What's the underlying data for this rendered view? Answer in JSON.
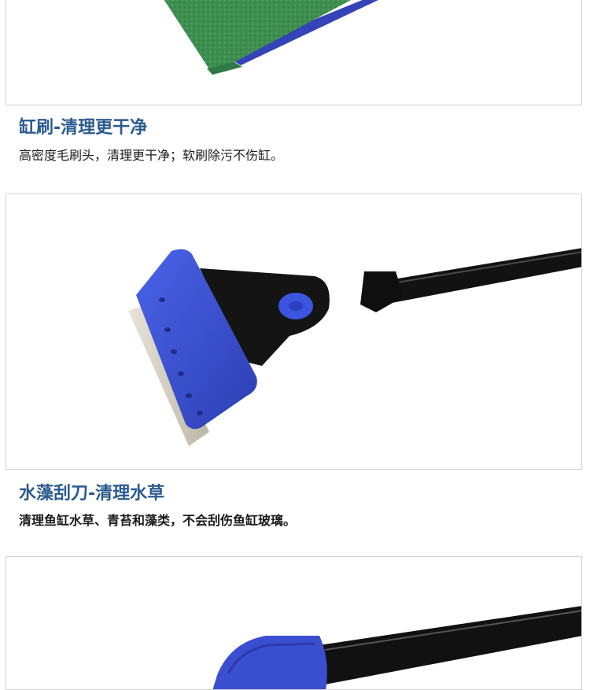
{
  "sections": [
    {
      "image": "sponge-brush-head-photo",
      "title": "缸刷-清理更干净",
      "description": "高密度毛刷头，清理更干净；软刷除污不伤缸。"
    },
    {
      "image": "algae-scraper-blade-photo",
      "title": "水藻刮刀-清理水草",
      "description": "清理鱼缸水草、青苔和藻类，不会刮伤鱼缸玻璃。"
    },
    {
      "image": "blue-head-handle-photo"
    }
  ],
  "colors": {
    "title": "#2a5a8f",
    "sponge_green": "#3a8f4e",
    "scraper_blue": "#3a4fd0",
    "handle_black": "#111111"
  }
}
